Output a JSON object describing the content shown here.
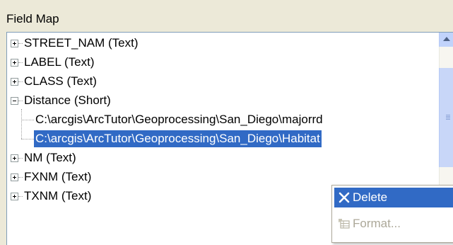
{
  "group": {
    "label": "Field Map"
  },
  "tree": {
    "items": [
      {
        "label": "STREET_NAM (Text)",
        "expanded": false
      },
      {
        "label": "LABEL (Text)",
        "expanded": false
      },
      {
        "label": "CLASS (Text)",
        "expanded": false
      },
      {
        "label": "Distance (Short)",
        "expanded": true
      },
      {
        "label": "C:\\arcgis\\ArcTutor\\Geoprocessing\\San_Diego\\majorrd",
        "child": true
      },
      {
        "label": "C:\\arcgis\\ArcTutor\\Geoprocessing\\San_Diego\\Habitat",
        "child": true,
        "selected": true
      },
      {
        "label": "NM (Text)",
        "expanded": false
      },
      {
        "label": "FXNM (Text)",
        "expanded": false
      },
      {
        "label": "TXNM (Text)",
        "expanded": false
      }
    ]
  },
  "context_menu": {
    "delete_label": "Delete",
    "format_label": "Format...",
    "delete_icon": "x-delete-icon",
    "format_icon": "format-table-icon"
  },
  "colors": {
    "selection": "#316ac5",
    "window_bg": "#ece9d8",
    "disabled_text": "#aca899"
  }
}
